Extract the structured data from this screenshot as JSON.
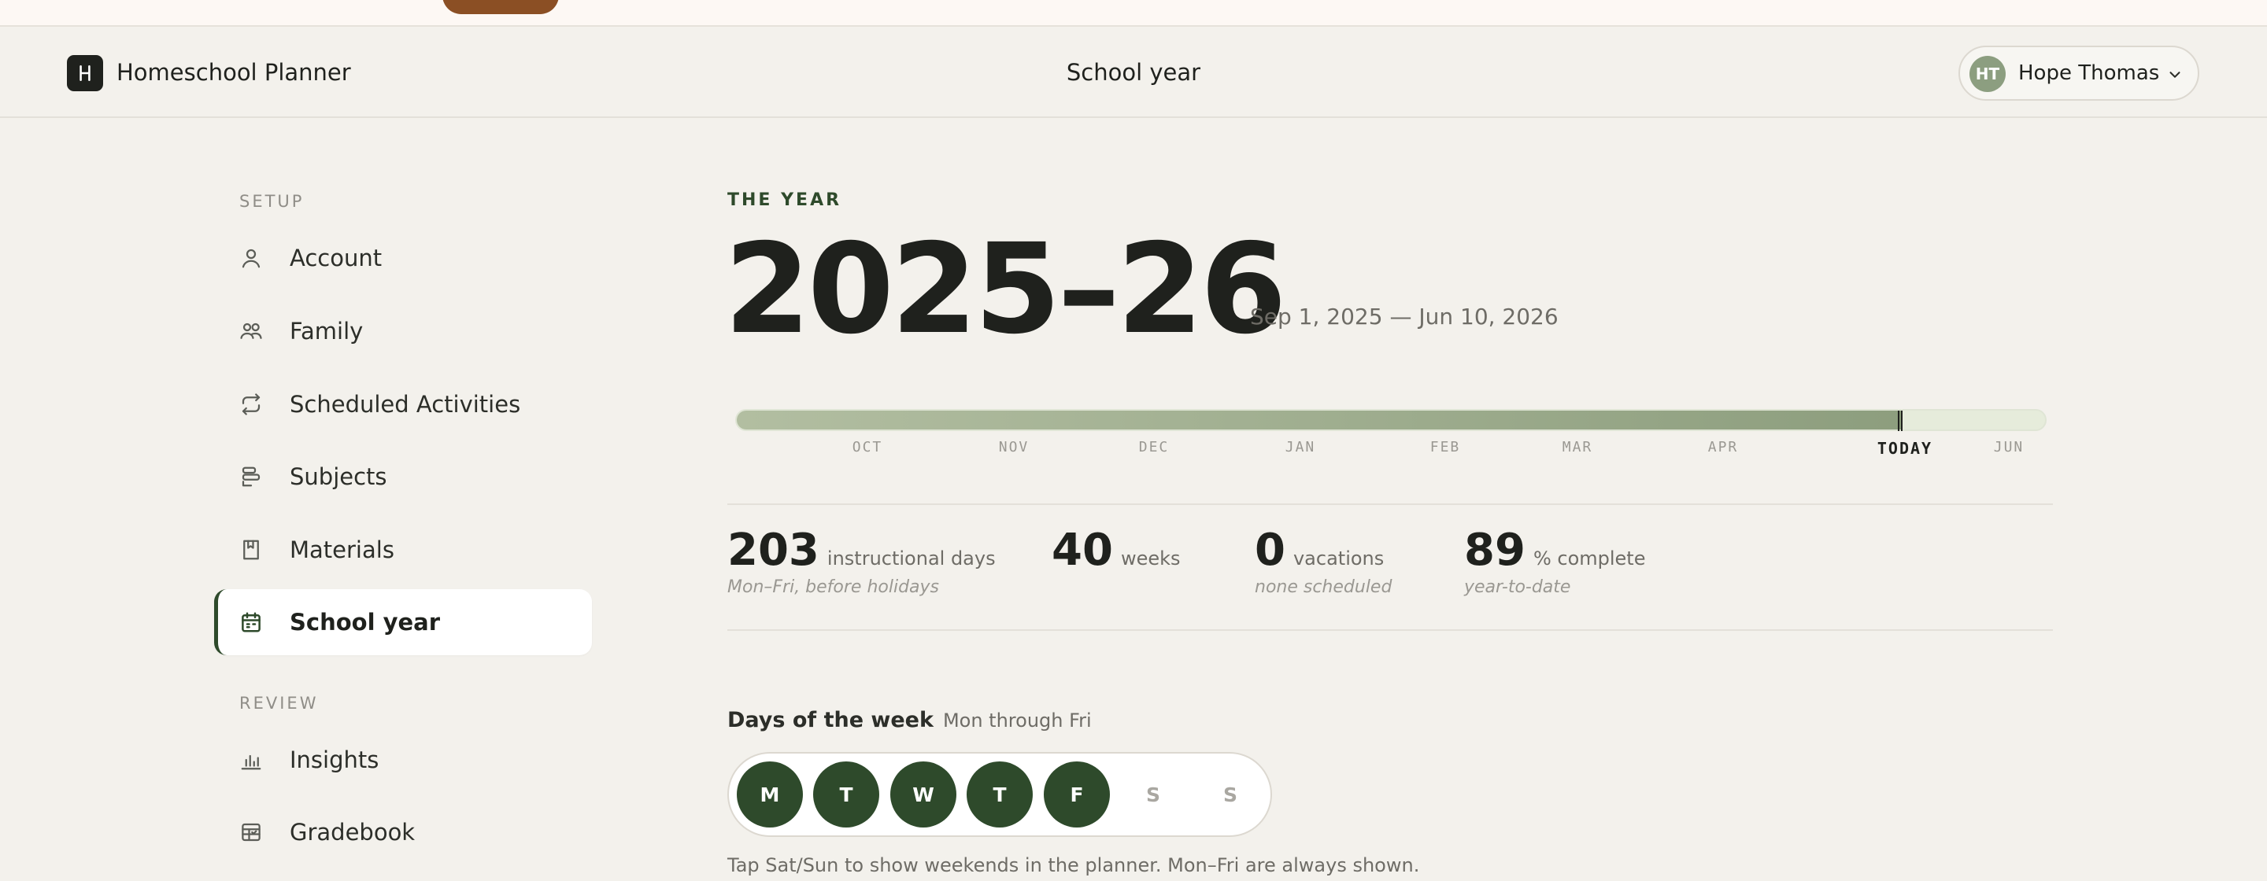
{
  "app": {
    "brand": "Homeschool Planner",
    "page_title": "School year",
    "user": {
      "initials": "HT",
      "name": "Hope Thomas"
    }
  },
  "sidebar": {
    "sections": [
      {
        "label": "SETUP"
      },
      {
        "label": "REVIEW"
      }
    ],
    "items": [
      {
        "label": "Account",
        "icon": "user-icon"
      },
      {
        "label": "Family",
        "icon": "users-icon"
      },
      {
        "label": "Scheduled Activities",
        "icon": "repeat-icon"
      },
      {
        "label": "Subjects",
        "icon": "subjects-icon"
      },
      {
        "label": "Materials",
        "icon": "bookmark-icon"
      },
      {
        "label": "School year",
        "icon": "calendar-icon",
        "active": true
      },
      {
        "label": "Insights",
        "icon": "bar-chart-icon"
      },
      {
        "label": "Gradebook",
        "icon": "table-icon"
      }
    ]
  },
  "year": {
    "eyebrow": "THE YEAR",
    "title": "2025–26",
    "range": "Sep 1, 2025 — Jun 10, 2026",
    "progress_fraction": 0.89,
    "months": [
      "OCT",
      "NOV",
      "DEC",
      "JAN",
      "FEB",
      "MAR",
      "APR",
      "TODAY",
      "JUN"
    ]
  },
  "stats": [
    {
      "value": "203",
      "unit": "instructional days",
      "sub": "Mon–Fri, before holidays"
    },
    {
      "value": "40",
      "unit": "weeks",
      "sub": ""
    },
    {
      "value": "0",
      "unit": "vacations",
      "sub": "none scheduled"
    },
    {
      "value": "89",
      "unit": "% complete",
      "sub": "year-to-date"
    }
  ],
  "days_of_week": {
    "title": "Days of the week",
    "subtitle": "Mon through Fri",
    "days": [
      {
        "label": "M",
        "on": true
      },
      {
        "label": "T",
        "on": true
      },
      {
        "label": "W",
        "on": true
      },
      {
        "label": "T",
        "on": true
      },
      {
        "label": "F",
        "on": true
      },
      {
        "label": "S",
        "on": false
      },
      {
        "label": "S",
        "on": false
      }
    ],
    "note": "Tap Sat/Sun to show weekends in the planner. Mon–Fri are always shown."
  },
  "colors": {
    "accent": "#2e4a2b",
    "background": "#f3f1ec",
    "avatar": "#8c9e80",
    "timeline_fill": "#8d9e7e",
    "timeline_track": "#e6ecdb"
  }
}
